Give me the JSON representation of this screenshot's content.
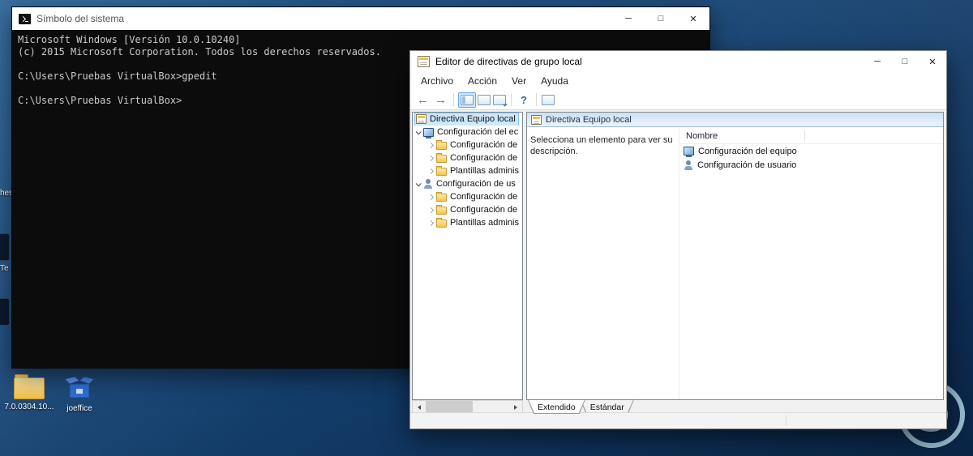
{
  "desktop": {
    "partial_labels": [
      "hes",
      "Te"
    ],
    "icons": [
      {
        "label": "7.0.0304.10..."
      },
      {
        "label": "joeffice"
      }
    ]
  },
  "cmd": {
    "title": "Símbolo del sistema",
    "controls": {
      "minimize": "─",
      "maximize": "□",
      "close": "✕"
    },
    "lines": [
      "Microsoft Windows [Versión 10.0.10240]",
      "(c) 2015 Microsoft Corporation. Todos los derechos reservados.",
      "",
      "C:\\Users\\Pruebas VirtualBox>gpedit",
      "",
      "C:\\Users\\Pruebas VirtualBox>"
    ]
  },
  "gpedit": {
    "title": "Editor de directivas de grupo local",
    "controls": {
      "minimize": "─",
      "maximize": "□",
      "close": "✕"
    },
    "menu": [
      "Archivo",
      "Acción",
      "Ver",
      "Ayuda"
    ],
    "toolbar": {
      "back_glyph": "←",
      "forward_glyph": "→",
      "help_glyph": "?"
    },
    "tree": {
      "rows": [
        {
          "label": "Directiva Equipo local",
          "level": 0,
          "selected": true
        },
        {
          "label": "Configuración del ec",
          "level": 1,
          "expanded": true
        },
        {
          "label": "Configuración de",
          "level": 2
        },
        {
          "label": "Configuración de",
          "level": 2
        },
        {
          "label": "Plantillas adminis",
          "level": 2
        },
        {
          "label": "Configuración de us",
          "level": 1,
          "expanded": true
        },
        {
          "label": "Configuración de",
          "level": 2
        },
        {
          "label": "Configuración de",
          "level": 2
        },
        {
          "label": "Plantillas adminis",
          "level": 2
        }
      ]
    },
    "content": {
      "header": "Directiva Equipo local",
      "description_line1": "Selecciona un elemento para ver su",
      "description_line2": "descripción.",
      "column_header": "Nombre",
      "items": [
        {
          "label": "Configuración del equipo"
        },
        {
          "label": "Configuración de usuario"
        }
      ]
    },
    "tabs": [
      {
        "label": "Extendido"
      },
      {
        "label": "Estándar"
      }
    ]
  }
}
